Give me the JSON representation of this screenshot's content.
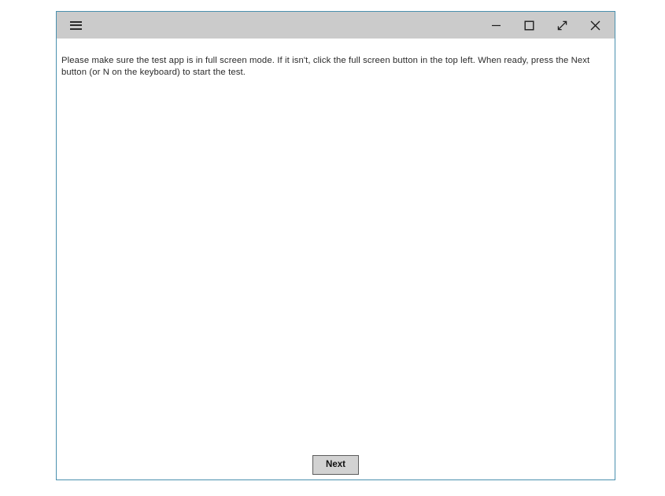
{
  "window": {
    "titlebar": {
      "menu_icon": "hamburger-menu-icon",
      "controls": [
        {
          "name": "minimize",
          "icon": "minimize-icon",
          "label": "Minimize"
        },
        {
          "name": "maximize",
          "icon": "maximize-square-icon",
          "label": "Maximize"
        },
        {
          "name": "fullscreen",
          "icon": "diagonal-double-arrow-icon",
          "label": "Full screen"
        },
        {
          "name": "close",
          "icon": "close-x-icon",
          "label": "Close"
        }
      ]
    },
    "content": {
      "instruction": "Please make sure the test app is in full screen mode. If it isn't, click the full screen button in the top left. When ready, press the Next button (or N on the keyboard) to start the test."
    },
    "footer": {
      "next_label": "Next"
    }
  },
  "colors": {
    "window_border": "#4a90ae",
    "titlebar_bg": "#cbcbcb",
    "content_bg": "#ffffff",
    "page_bg": "#ffffff",
    "text": "#2b2b2b",
    "button_bg": "#d2d2d2",
    "button_border": "#5c5c5c"
  }
}
